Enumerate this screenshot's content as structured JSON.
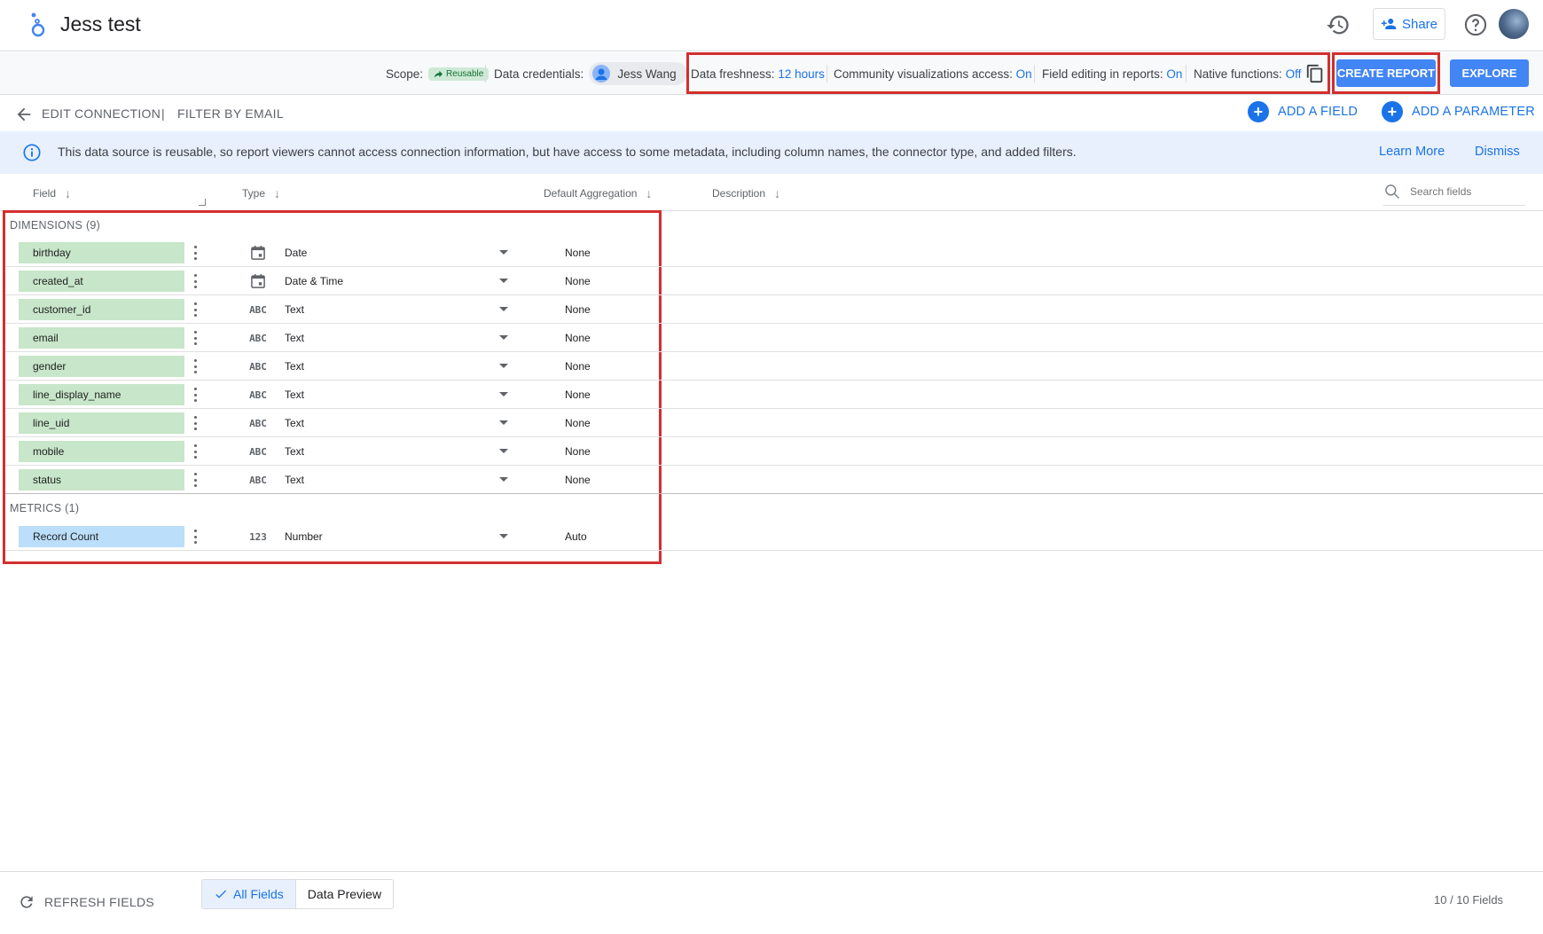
{
  "header": {
    "title": "Jess test",
    "share_label": "Share",
    "icons": [
      "looker-studio-logo",
      "history-icon",
      "person-add-icon",
      "help-icon",
      "avatar"
    ]
  },
  "infobar": {
    "scope_label": "Scope:",
    "scope_chip": "Reusable",
    "credentials_label": "Data credentials:",
    "credentials_user": "Jess Wang",
    "freshness_label": "Data freshness:",
    "freshness_value": "12 hours",
    "community_label": "Community visualizations access:",
    "community_value": "On",
    "field_editing_label": "Field editing in reports:",
    "field_editing_value": "On",
    "native_label": "Native functions:",
    "native_value": "Off",
    "create_report": "CREATE REPORT",
    "explore": "EXPLORE"
  },
  "toolbar": {
    "edit_connection": "EDIT CONNECTION",
    "separator": "|",
    "filter_by_email": "FILTER BY EMAIL",
    "add_field": "ADD A FIELD",
    "add_parameter": "ADD A PARAMETER"
  },
  "banner": {
    "text": "This data source is reusable, so report viewers cannot access connection information, but have access to some metadata, including column names, the connector type, and added filters.",
    "learn_more": "Learn More",
    "dismiss": "Dismiss"
  },
  "columns": {
    "field": "Field",
    "type": "Type",
    "aggregation": "Default Aggregation",
    "description": "Description",
    "search_placeholder": "Search fields"
  },
  "dimensions": {
    "label": "DIMENSIONS (9)",
    "rows": [
      {
        "name": "birthday",
        "type_icon": "calendar-icon",
        "type": "Date",
        "agg": "None"
      },
      {
        "name": "created_at",
        "type_icon": "calendar-icon",
        "type": "Date & Time",
        "agg": "None"
      },
      {
        "name": "customer_id",
        "type_icon": "ABC",
        "type": "Text",
        "agg": "None"
      },
      {
        "name": "email",
        "type_icon": "ABC",
        "type": "Text",
        "agg": "None"
      },
      {
        "name": "gender",
        "type_icon": "ABC",
        "type": "Text",
        "agg": "None"
      },
      {
        "name": "line_display_name",
        "type_icon": "ABC",
        "type": "Text",
        "agg": "None"
      },
      {
        "name": "line_uid",
        "type_icon": "ABC",
        "type": "Text",
        "agg": "None"
      },
      {
        "name": "mobile",
        "type_icon": "ABC",
        "type": "Text",
        "agg": "None"
      },
      {
        "name": "status",
        "type_icon": "ABC",
        "type": "Text",
        "agg": "None"
      }
    ]
  },
  "metrics": {
    "label": "METRICS (1)",
    "rows": [
      {
        "name": "Record Count",
        "type_icon": "123",
        "type": "Number",
        "agg": "Auto"
      }
    ]
  },
  "footer": {
    "refresh": "REFRESH FIELDS",
    "all_fields": "All Fields",
    "data_preview": "Data Preview",
    "count": "10 / 10 Fields"
  },
  "colors": {
    "accent": "#1a73e8",
    "button": "#4285f4",
    "dimension_chip": "#c8e6c9",
    "metric_chip": "#bbdefb",
    "highlight_box": "#d32f2f"
  }
}
